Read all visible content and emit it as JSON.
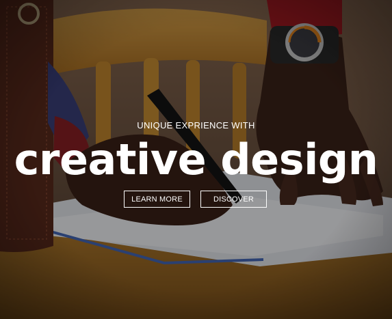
{
  "hero": {
    "subtitle": "UNIQUE EXPRIENCE WITH",
    "title": "creative design",
    "buttons": {
      "learn_more": "LEARN MORE",
      "discover": "DISCOVER"
    }
  },
  "colors": {
    "text": "#ffffff",
    "button_border": "#ffffff"
  }
}
